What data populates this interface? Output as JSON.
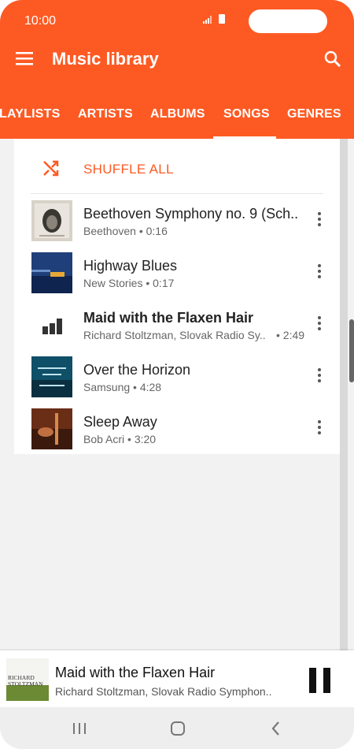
{
  "status_bar": {
    "time": "10:00"
  },
  "app_bar": {
    "title": "Music library",
    "menu_icon": "menu-icon",
    "search_icon": "search-icon"
  },
  "tabs": [
    {
      "label": "LAYLISTS"
    },
    {
      "label": "ARTISTS"
    },
    {
      "label": "ALBUMS"
    },
    {
      "label": "SONGS",
      "selected": true
    },
    {
      "label": "GENRES"
    }
  ],
  "shuffle": {
    "label": "SHUFFLE ALL",
    "icon": "shuffle-icon"
  },
  "songs": [
    {
      "title": "Beethoven Symphony no. 9 (Sch..",
      "subtitle": "Beethoven • 0:16",
      "art": "album-art-beethoven"
    },
    {
      "title": "Highway Blues",
      "subtitle": "New Stories • 0:17",
      "art": "album-art-highway"
    },
    {
      "title": "Maid with the Flaxen Hair",
      "subtitle": "Richard Stoltzman, Slovak Radio Sy..",
      "duration": "• 2:49",
      "art": "playing-equalizer-icon",
      "playing": true
    },
    {
      "title": "Over the Horizon",
      "subtitle": "Samsung • 4:28",
      "art": "album-art-horizon"
    },
    {
      "title": "Sleep Away",
      "subtitle": "Bob Acri • 3:20",
      "art": "album-art-sleep"
    }
  ],
  "now_playing": {
    "title": "Maid with the Flaxen Hair",
    "artist": "Richard Stoltzman, Slovak Radio Symphon..",
    "art_text_1": "RICHARD",
    "art_text_2": "STOLTZMAN"
  },
  "colors": {
    "accent": "#fd5a23",
    "background": "#f2f2f2"
  },
  "nav": {
    "recent": "recents-icon",
    "home": "home-icon",
    "back": "back-icon"
  }
}
